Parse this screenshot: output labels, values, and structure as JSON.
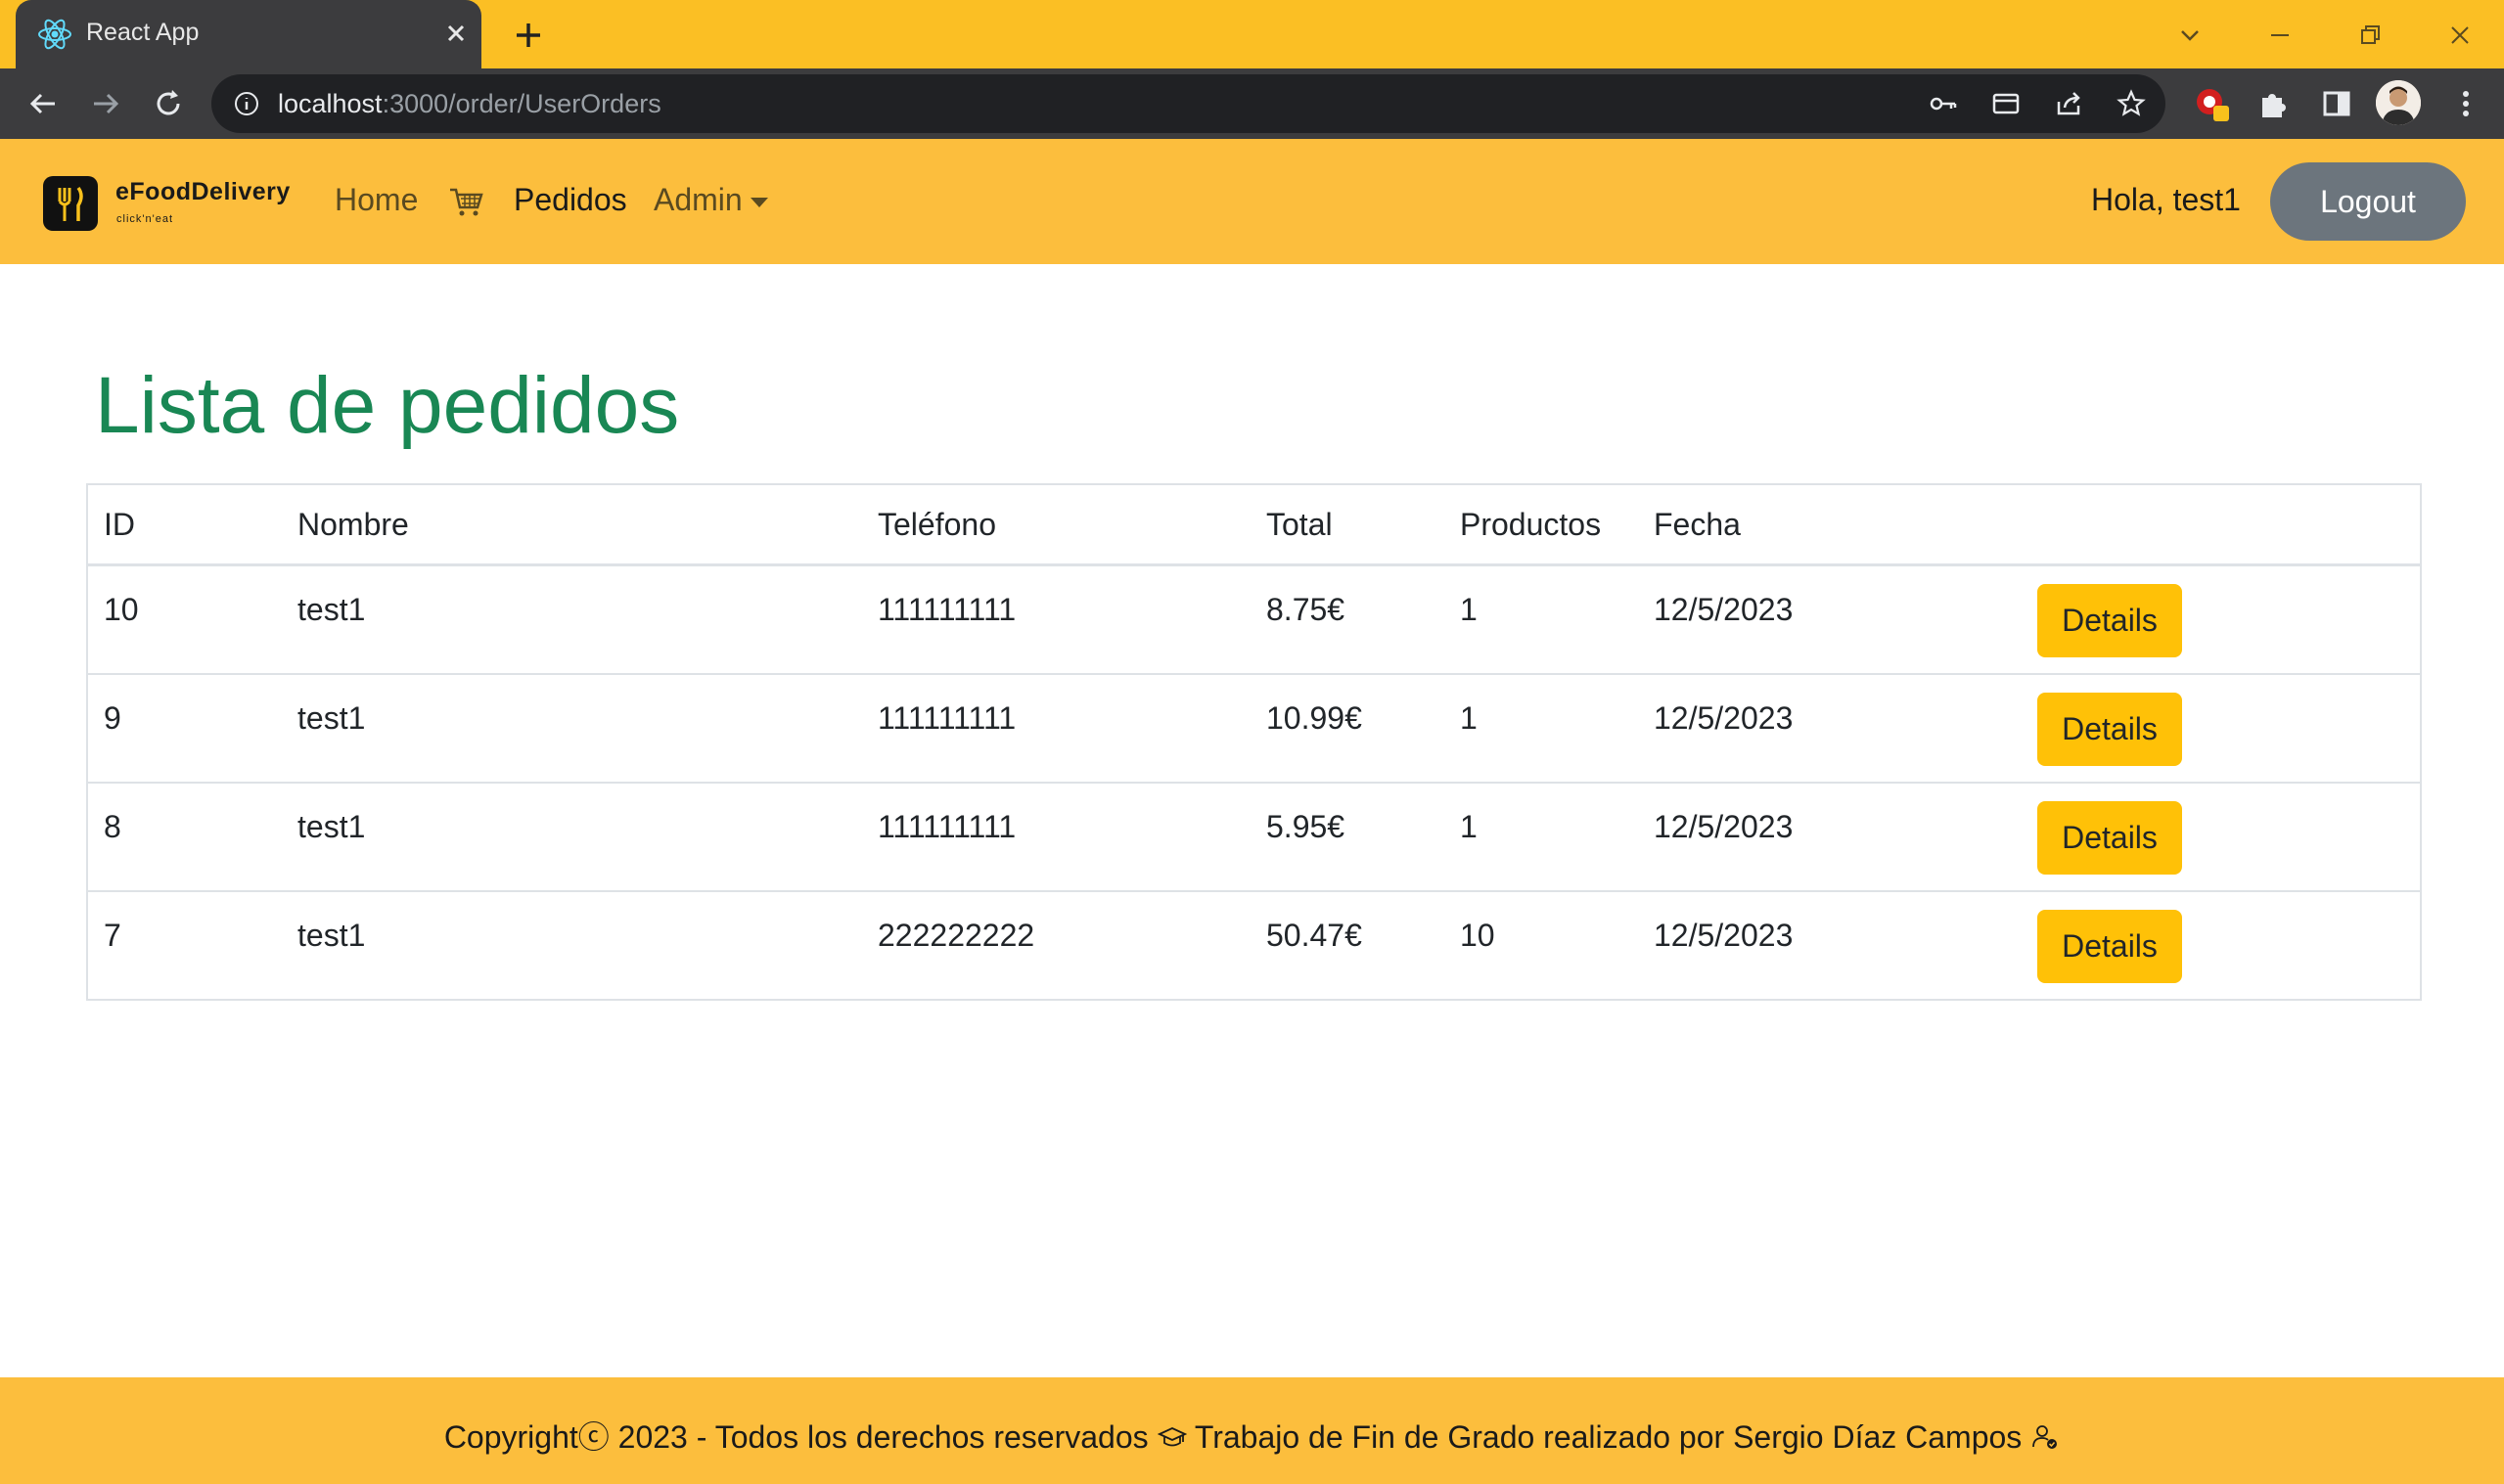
{
  "browser": {
    "tab_title": "React App",
    "url_host": "localhost",
    "url_rest": ":3000/order/UserOrders"
  },
  "navbar": {
    "brand_name": "eFoodDelivery",
    "brand_tagline": "click'n'eat",
    "links": {
      "home": "Home",
      "orders": "Pedidos",
      "admin": "Admin"
    },
    "greeting": "Hola, test1",
    "logout_label": "Logout"
  },
  "main": {
    "title": "Lista de pedidos",
    "table": {
      "headers": [
        "ID",
        "Nombre",
        "Teléfono",
        "Total",
        "Productos",
        "Fecha",
        ""
      ],
      "rows": [
        {
          "id": "10",
          "name": "test1",
          "phone": "111111111",
          "total": "8.75€",
          "products": "1",
          "date": "12/5/2023",
          "action": "Details"
        },
        {
          "id": "9",
          "name": "test1",
          "phone": "111111111",
          "total": "10.99€",
          "products": "1",
          "date": "12/5/2023",
          "action": "Details"
        },
        {
          "id": "8",
          "name": "test1",
          "phone": "111111111",
          "total": "5.95€",
          "products": "1",
          "date": "12/5/2023",
          "action": "Details"
        },
        {
          "id": "7",
          "name": "test1",
          "phone": "222222222",
          "total": "50.47€",
          "products": "10",
          "date": "12/5/2023",
          "action": "Details"
        }
      ]
    }
  },
  "footer": {
    "text_part1": "Copyrightⓒ 2023 - Todos los derechos reservados",
    "text_part2": "Trabajo de Fin de Grado realizado por Sergio Díaz Campos"
  },
  "colors": {
    "accent_yellow": "#fcbe3d",
    "title_green": "#198754",
    "details_button": "#ffc107",
    "logout_button": "#6c757d"
  },
  "icons": [
    "react-icon",
    "close-icon",
    "plus-icon",
    "back-icon",
    "forward-icon",
    "reload-icon",
    "info-icon",
    "key-icon",
    "card-icon",
    "share-icon",
    "star-icon",
    "extension-icon",
    "puzzle-icon",
    "sidepanel-icon",
    "menu-icon",
    "cart-icon",
    "graduation-cap-icon",
    "user-check-icon"
  ]
}
